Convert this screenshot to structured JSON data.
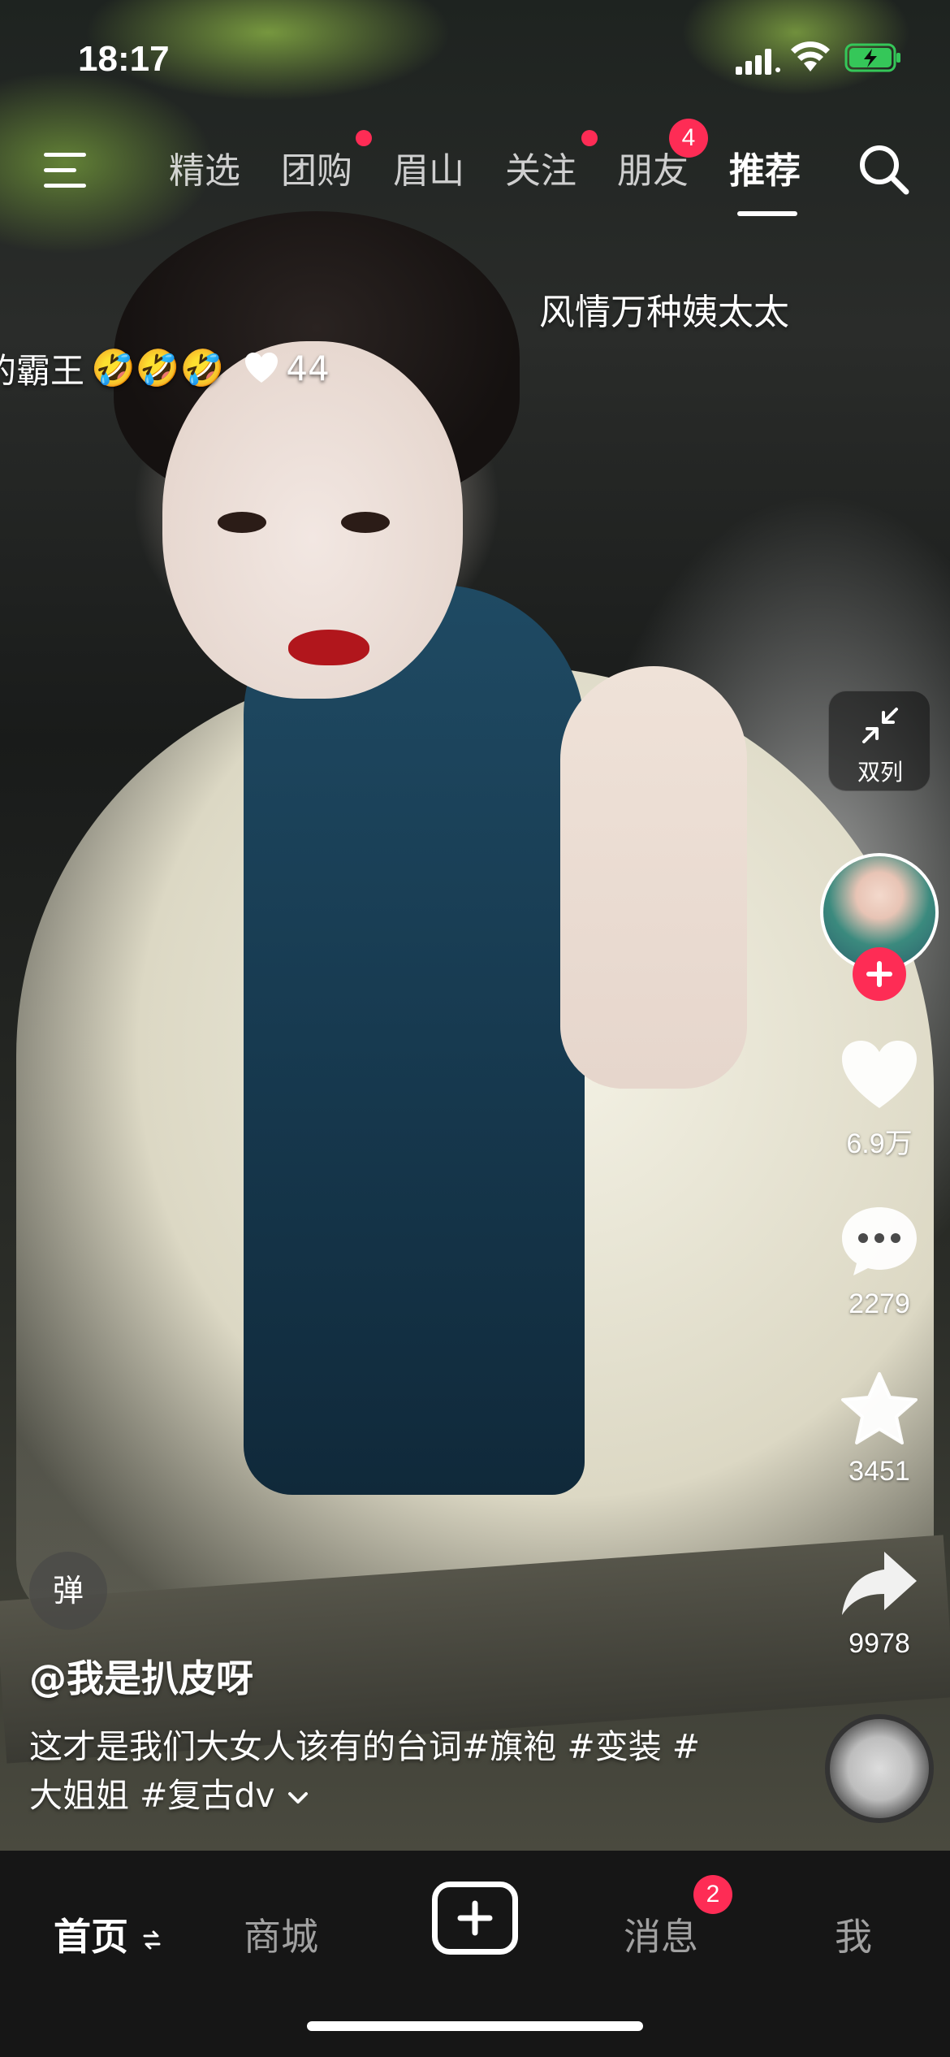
{
  "status_bar": {
    "time": "18:17"
  },
  "top_nav": {
    "tabs": [
      {
        "label": "精选"
      },
      {
        "label": "团购"
      },
      {
        "label": "眉山"
      },
      {
        "label": "关注"
      },
      {
        "label": "朋友",
        "badge": "4"
      },
      {
        "label": "推荐"
      }
    ],
    "active_tab": "推荐"
  },
  "video": {
    "subtitle": "风情万种姨太太",
    "danmaku": {
      "text": "的霸王",
      "emojis": "🤣🤣🤣",
      "likes": "44"
    },
    "author": "@我是扒皮呀",
    "caption_line1": "这才是我们大女人该有的台词#旗袍 #变装 #",
    "caption_line2": "大姐姐 #复古dv"
  },
  "right_rail": {
    "double_column_label": "双列",
    "likes": "6.9万",
    "comments": "2279",
    "favorites": "3451",
    "shares": "9978"
  },
  "danmaku_toggle_label": "弹",
  "bottom_nav": {
    "home": "首页",
    "mall": "商城",
    "messages": "消息",
    "messages_badge": "2",
    "me": "我"
  },
  "colors": {
    "accent": "#fe2c55",
    "nav_bg": "#161616"
  }
}
